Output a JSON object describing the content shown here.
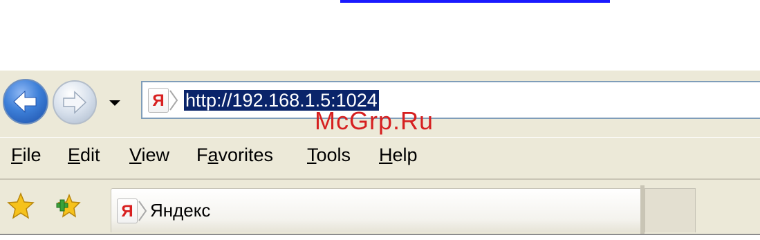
{
  "window": {
    "watermark": "McGrp.Ru"
  },
  "toolbar": {
    "back_icon": "back-arrow-icon",
    "forward_icon": "forward-arrow-icon",
    "history_icon": "dropdown-arrow-icon"
  },
  "address_bar": {
    "favicon_letter": "Я",
    "url": "http://192.168.1.5:1024",
    "selection_color": "#0a246a"
  },
  "menu": {
    "items": [
      {
        "label": "File",
        "accel_index": 0
      },
      {
        "label": "Edit",
        "accel_index": 0
      },
      {
        "label": "View",
        "accel_index": 0
      },
      {
        "label": "Favorites",
        "accel_index": 1
      },
      {
        "label": "Tools",
        "accel_index": 0
      },
      {
        "label": "Help",
        "accel_index": 0
      }
    ]
  },
  "favorites_bar": {
    "favorites_icon": "star-icon",
    "add_favorite_icon": "add-favorite-icon",
    "tab_favicon_letter": "Я",
    "tab_label": "Яндекс"
  },
  "colors": {
    "chrome": "#ece9d8",
    "brand_red": "#d82020"
  }
}
